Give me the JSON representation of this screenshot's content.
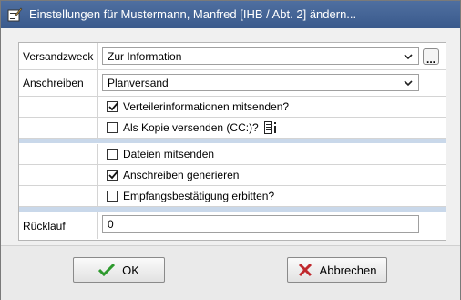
{
  "window": {
    "title": "Einstellungen für Mustermann, Manfred [IHB / Abt. 2] ändern..."
  },
  "form": {
    "versandzweck": {
      "label": "Versandzweck",
      "value": "Zur Information",
      "more_button": "..."
    },
    "anschreiben": {
      "label": "Anschreiben",
      "value": "Planversand"
    },
    "verteilerinfo": {
      "label": "Verteilerinformationen mitsenden?",
      "checked": true
    },
    "kopie": {
      "label": "Als Kopie versenden (CC:)?",
      "checked": false,
      "icon": "info-list-icon"
    },
    "dateien": {
      "label": "Dateien mitsenden",
      "checked": false
    },
    "generieren": {
      "label": "Anschreiben generieren",
      "checked": true
    },
    "empfang": {
      "label": "Empfangsbestätigung erbitten?",
      "checked": false
    },
    "ruecklauf": {
      "label": "Rücklauf",
      "value": "0"
    }
  },
  "buttons": {
    "ok": {
      "label": "OK",
      "icon": "checkmark-icon",
      "color": "#2e9a2e"
    },
    "cancel": {
      "label": "Abbrechen",
      "icon": "x-icon",
      "color": "#c0282d"
    }
  }
}
